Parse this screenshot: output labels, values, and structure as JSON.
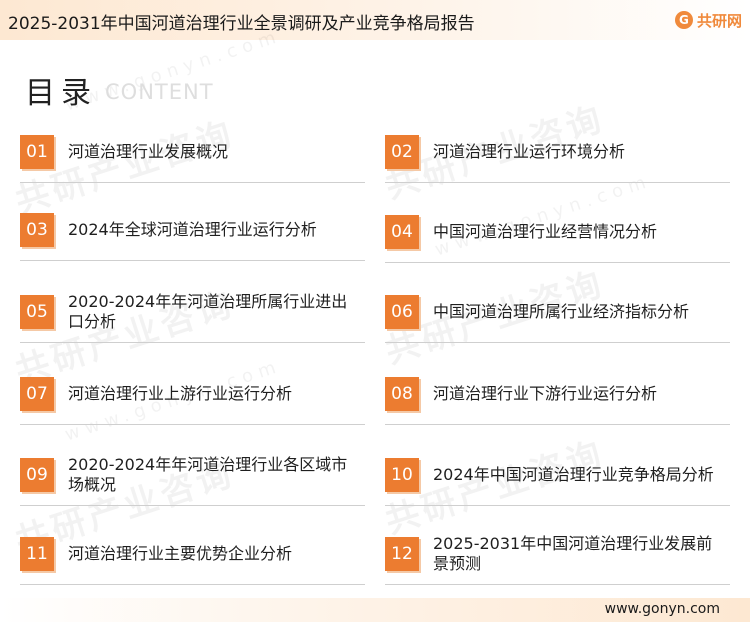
{
  "header": {
    "title": "2025-2031年中国河道治理行业全景调研及产业竞争格局报告",
    "logo_mark": "G",
    "logo_text": "共研网"
  },
  "toc": {
    "heading": "目录",
    "heading_sub": "CONTENT",
    "items": [
      {
        "num": "01",
        "label": "河道治理行业发展概况"
      },
      {
        "num": "02",
        "label": "河道治理行业运行环境分析"
      },
      {
        "num": "03",
        "label": "2024年全球河道治理行业运行分析"
      },
      {
        "num": "04",
        "label": "中国河道治理行业经营情况分析"
      },
      {
        "num": "05",
        "label": "2020-2024年年河道治理所属行业进出口分析"
      },
      {
        "num": "06",
        "label": "中国河道治理所属行业经济指标分析"
      },
      {
        "num": "07",
        "label": "河道治理行业上游行业运行分析"
      },
      {
        "num": "08",
        "label": "河道治理行业下游行业运行分析"
      },
      {
        "num": "09",
        "label": "2020-2024年年河道治理行业各区域市场概况"
      },
      {
        "num": "10",
        "label": "2024年中国河道治理行业竞争格局分析"
      },
      {
        "num": "11",
        "label": "河道治理行业主要优势企业分析"
      },
      {
        "num": "12",
        "label": "2025-2031年中国河道治理行业发展前景预测"
      }
    ]
  },
  "watermark": {
    "text": "共研产业咨询",
    "url": "www.gonyn.com"
  },
  "footer": {
    "url": "www.gonyn.com"
  },
  "colors": {
    "accent": "#ec7c30",
    "accent_shadow": "#f5c9a6",
    "bar_tint": "#fde8d2"
  }
}
